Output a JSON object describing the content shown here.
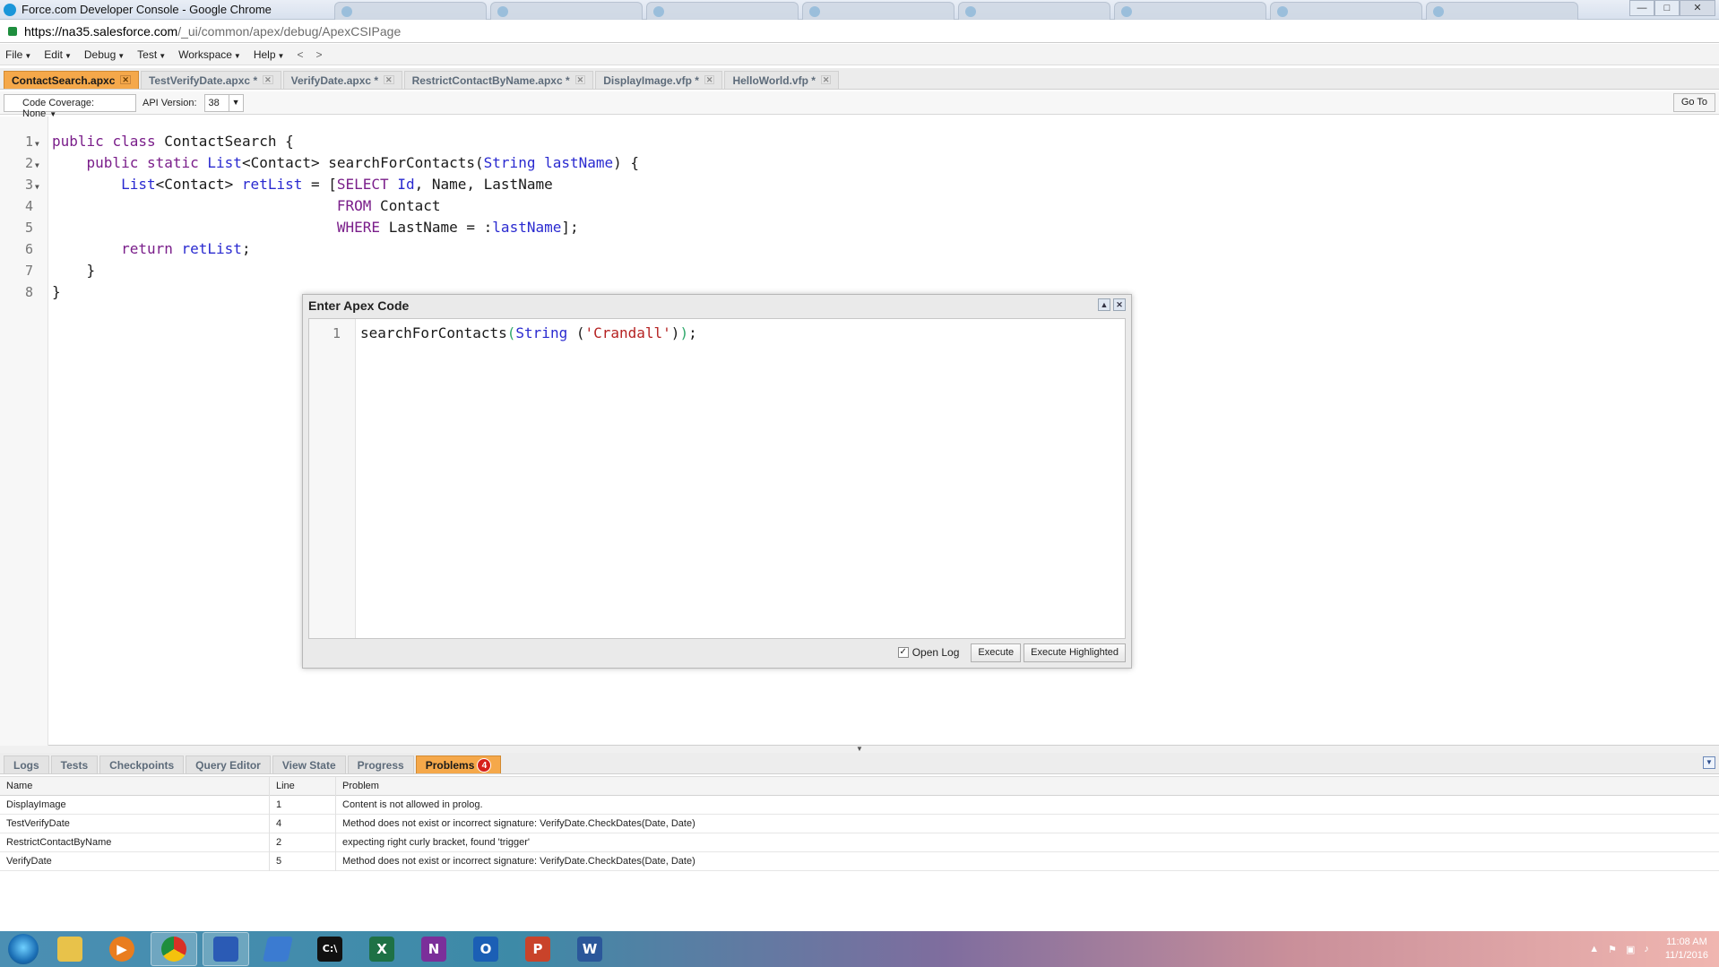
{
  "window": {
    "title": "Force.com Developer Console - Google Chrome",
    "min_label": "—",
    "max_label": "□",
    "close_label": "✕"
  },
  "address_bar": {
    "url_scheme_host": "https://na35.salesforce.com",
    "url_path": "/_ui/common/apex/debug/ApexCSIPage"
  },
  "menubar": {
    "items": [
      {
        "label": "File"
      },
      {
        "label": "Edit"
      },
      {
        "label": "Debug"
      },
      {
        "label": "Test"
      },
      {
        "label": "Workspace"
      },
      {
        "label": "Help"
      }
    ],
    "back": "<",
    "forward": ">"
  },
  "file_tabs": [
    {
      "label": "ContactSearch.apxc",
      "active": true
    },
    {
      "label": "TestVerifyDate.apxc *",
      "active": false
    },
    {
      "label": "VerifyDate.apxc *",
      "active": false
    },
    {
      "label": "RestrictContactByName.apxc *",
      "active": false
    },
    {
      "label": "DisplayImage.vfp *",
      "active": false
    },
    {
      "label": "HelloWorld.vfp *",
      "active": false
    }
  ],
  "toolbar": {
    "coverage_label": "Code Coverage: None",
    "api_label": "API Version:",
    "api_value": "38",
    "goto_label": "Go To"
  },
  "editor": {
    "line_numbers": [
      "1",
      "2",
      "3",
      "4",
      "5",
      "6",
      "7",
      "8"
    ],
    "lines": [
      "public class ContactSearch {",
      "    public static List<Contact> searchForContacts(String lastName) {",
      "        List<Contact> retList = [SELECT Id, Name, LastName",
      "                                 FROM Contact",
      "                                 WHERE LastName = :lastName];",
      "        return retList;",
      "    }",
      "}"
    ]
  },
  "dialog": {
    "title": "Enter Apex Code",
    "line_number": "1",
    "code": "searchForContacts(String ('Crandall'));",
    "open_log_label": "Open Log",
    "open_log_checked": true,
    "execute_label": "Execute",
    "execute_highlighted_label": "Execute Highlighted"
  },
  "panel": {
    "tabs": [
      {
        "label": "Logs"
      },
      {
        "label": "Tests"
      },
      {
        "label": "Checkpoints"
      },
      {
        "label": "Query Editor"
      },
      {
        "label": "View State"
      },
      {
        "label": "Progress"
      },
      {
        "label": "Problems",
        "badge": "4",
        "active": true
      }
    ],
    "columns": {
      "name": "Name",
      "line": "Line",
      "problem": "Problem"
    },
    "rows": [
      {
        "name": "DisplayImage",
        "line": "1",
        "problem": "Content is not allowed in prolog."
      },
      {
        "name": "TestVerifyDate",
        "line": "4",
        "problem": "Method does not exist or incorrect signature: VerifyDate.CheckDates(Date, Date)"
      },
      {
        "name": "RestrictContactByName",
        "line": "2",
        "problem": "expecting right curly bracket, found 'trigger'"
      },
      {
        "name": "VerifyDate",
        "line": "5",
        "problem": "Method does not exist or incorrect signature: VerifyDate.CheckDates(Date, Date)"
      }
    ]
  },
  "taskbar": {
    "time": "11:08 AM",
    "date": "11/1/2016"
  },
  "colors": {
    "active_tab": "#f5a84a",
    "keyword": "#7a1e8a",
    "type": "#2a2ad0",
    "string": "#b52222",
    "badge": "#d6201a"
  }
}
